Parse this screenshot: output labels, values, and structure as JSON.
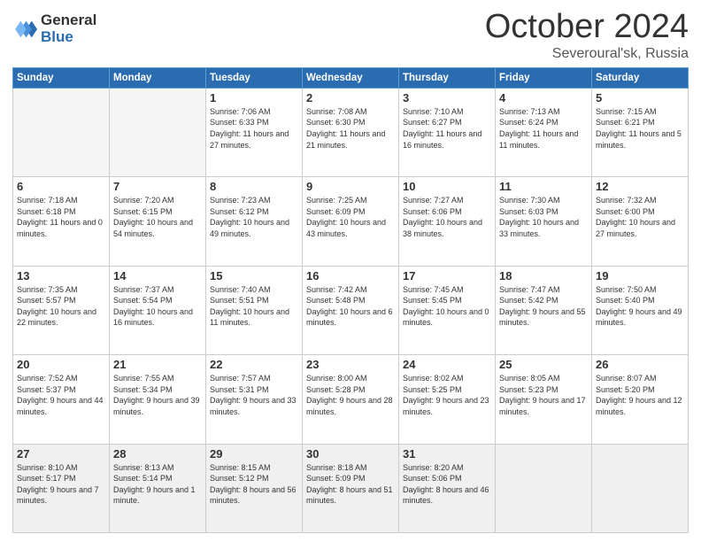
{
  "header": {
    "logo_line1": "General",
    "logo_line2": "Blue",
    "month": "October 2024",
    "location": "Severoural'sk, Russia"
  },
  "weekdays": [
    "Sunday",
    "Monday",
    "Tuesday",
    "Wednesday",
    "Thursday",
    "Friday",
    "Saturday"
  ],
  "weeks": [
    [
      {
        "day": "",
        "info": ""
      },
      {
        "day": "",
        "info": ""
      },
      {
        "day": "1",
        "info": "Sunrise: 7:06 AM\nSunset: 6:33 PM\nDaylight: 11 hours and 27 minutes."
      },
      {
        "day": "2",
        "info": "Sunrise: 7:08 AM\nSunset: 6:30 PM\nDaylight: 11 hours and 21 minutes."
      },
      {
        "day": "3",
        "info": "Sunrise: 7:10 AM\nSunset: 6:27 PM\nDaylight: 11 hours and 16 minutes."
      },
      {
        "day": "4",
        "info": "Sunrise: 7:13 AM\nSunset: 6:24 PM\nDaylight: 11 hours and 11 minutes."
      },
      {
        "day": "5",
        "info": "Sunrise: 7:15 AM\nSunset: 6:21 PM\nDaylight: 11 hours and 5 minutes."
      }
    ],
    [
      {
        "day": "6",
        "info": "Sunrise: 7:18 AM\nSunset: 6:18 PM\nDaylight: 11 hours and 0 minutes."
      },
      {
        "day": "7",
        "info": "Sunrise: 7:20 AM\nSunset: 6:15 PM\nDaylight: 10 hours and 54 minutes."
      },
      {
        "day": "8",
        "info": "Sunrise: 7:23 AM\nSunset: 6:12 PM\nDaylight: 10 hours and 49 minutes."
      },
      {
        "day": "9",
        "info": "Sunrise: 7:25 AM\nSunset: 6:09 PM\nDaylight: 10 hours and 43 minutes."
      },
      {
        "day": "10",
        "info": "Sunrise: 7:27 AM\nSunset: 6:06 PM\nDaylight: 10 hours and 38 minutes."
      },
      {
        "day": "11",
        "info": "Sunrise: 7:30 AM\nSunset: 6:03 PM\nDaylight: 10 hours and 33 minutes."
      },
      {
        "day": "12",
        "info": "Sunrise: 7:32 AM\nSunset: 6:00 PM\nDaylight: 10 hours and 27 minutes."
      }
    ],
    [
      {
        "day": "13",
        "info": "Sunrise: 7:35 AM\nSunset: 5:57 PM\nDaylight: 10 hours and 22 minutes."
      },
      {
        "day": "14",
        "info": "Sunrise: 7:37 AM\nSunset: 5:54 PM\nDaylight: 10 hours and 16 minutes."
      },
      {
        "day": "15",
        "info": "Sunrise: 7:40 AM\nSunset: 5:51 PM\nDaylight: 10 hours and 11 minutes."
      },
      {
        "day": "16",
        "info": "Sunrise: 7:42 AM\nSunset: 5:48 PM\nDaylight: 10 hours and 6 minutes."
      },
      {
        "day": "17",
        "info": "Sunrise: 7:45 AM\nSunset: 5:45 PM\nDaylight: 10 hours and 0 minutes."
      },
      {
        "day": "18",
        "info": "Sunrise: 7:47 AM\nSunset: 5:42 PM\nDaylight: 9 hours and 55 minutes."
      },
      {
        "day": "19",
        "info": "Sunrise: 7:50 AM\nSunset: 5:40 PM\nDaylight: 9 hours and 49 minutes."
      }
    ],
    [
      {
        "day": "20",
        "info": "Sunrise: 7:52 AM\nSunset: 5:37 PM\nDaylight: 9 hours and 44 minutes."
      },
      {
        "day": "21",
        "info": "Sunrise: 7:55 AM\nSunset: 5:34 PM\nDaylight: 9 hours and 39 minutes."
      },
      {
        "day": "22",
        "info": "Sunrise: 7:57 AM\nSunset: 5:31 PM\nDaylight: 9 hours and 33 minutes."
      },
      {
        "day": "23",
        "info": "Sunrise: 8:00 AM\nSunset: 5:28 PM\nDaylight: 9 hours and 28 minutes."
      },
      {
        "day": "24",
        "info": "Sunrise: 8:02 AM\nSunset: 5:25 PM\nDaylight: 9 hours and 23 minutes."
      },
      {
        "day": "25",
        "info": "Sunrise: 8:05 AM\nSunset: 5:23 PM\nDaylight: 9 hours and 17 minutes."
      },
      {
        "day": "26",
        "info": "Sunrise: 8:07 AM\nSunset: 5:20 PM\nDaylight: 9 hours and 12 minutes."
      }
    ],
    [
      {
        "day": "27",
        "info": "Sunrise: 8:10 AM\nSunset: 5:17 PM\nDaylight: 9 hours and 7 minutes."
      },
      {
        "day": "28",
        "info": "Sunrise: 8:13 AM\nSunset: 5:14 PM\nDaylight: 9 hours and 1 minute."
      },
      {
        "day": "29",
        "info": "Sunrise: 8:15 AM\nSunset: 5:12 PM\nDaylight: 8 hours and 56 minutes."
      },
      {
        "day": "30",
        "info": "Sunrise: 8:18 AM\nSunset: 5:09 PM\nDaylight: 8 hours and 51 minutes."
      },
      {
        "day": "31",
        "info": "Sunrise: 8:20 AM\nSunset: 5:06 PM\nDaylight: 8 hours and 46 minutes."
      },
      {
        "day": "",
        "info": ""
      },
      {
        "day": "",
        "info": ""
      }
    ]
  ]
}
